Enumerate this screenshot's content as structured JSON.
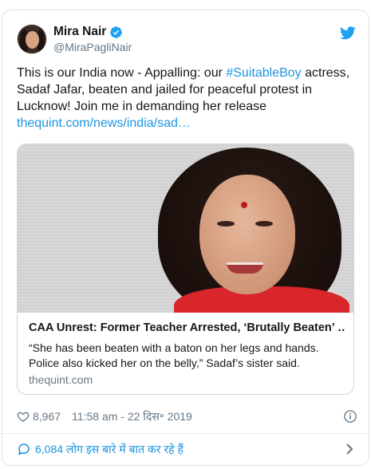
{
  "author": {
    "name": "Mira Nair",
    "handle": "@MiraPagliNair"
  },
  "tweet": {
    "text_before_hashtag": "This is our India now - Appalling: our ",
    "hashtag": "#SuitableBoy",
    "text_after_hashtag": " actress, Sadaf Jafar, beaten and jailed for peaceful protest in Lucknow! Join me in demanding her release",
    "link": "thequint.com/news/india/sad…"
  },
  "card": {
    "title": "CAA Unrest: Former Teacher Arrested, ‘Brutally Beaten’ …",
    "description": "“She has been beaten with a baton on her legs and hands. Police also kicked her on the belly,” Sadaf’s sister said.",
    "domain": "thequint.com"
  },
  "meta": {
    "likes": "8,967",
    "timestamp": "11:58 am - 22 दिस॰ 2019"
  },
  "footer": {
    "conversation": "6,084 लोग इस बारे में बात कर रहे हैं"
  },
  "colors": {
    "link": "#1b95e0",
    "verified": "#1da1f2",
    "secondary_text": "#657786"
  },
  "icons": [
    "verified-badge-icon",
    "twitter-bird-icon",
    "heart-icon",
    "info-icon",
    "chat-bubble-icon",
    "chevron-right-icon"
  ]
}
